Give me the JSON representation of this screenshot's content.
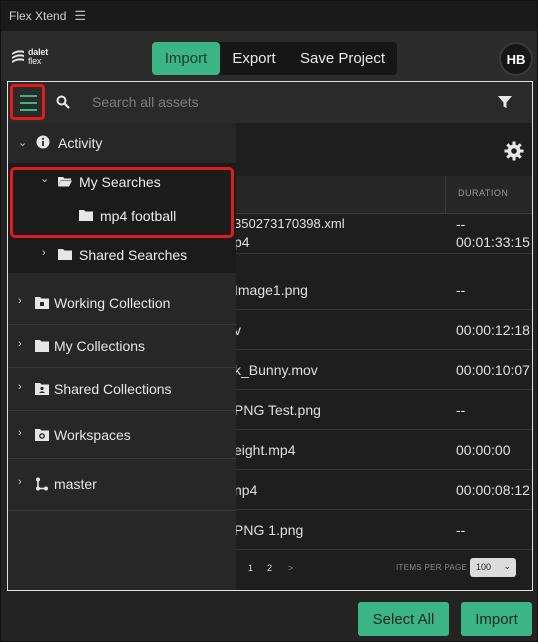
{
  "app": {
    "title": "Flex Xtend",
    "menu_icon": "hamburger-menu-icon"
  },
  "logo": {
    "line1": "dalet",
    "line2": "flex"
  },
  "tabs": [
    {
      "label": "Import",
      "active": true
    },
    {
      "label": "Export",
      "active": false
    },
    {
      "label": "Save Project",
      "active": false
    }
  ],
  "avatar": {
    "initials": "HB"
  },
  "search": {
    "placeholder": "Search all assets",
    "value": ""
  },
  "table": {
    "duration_header": "DURATION",
    "rows": [
      {
        "name": "350273170398.xml",
        "name_line2": "p4",
        "duration": "--",
        "duration_line2": "00:01:33:15"
      },
      {
        "name": "Image1.png",
        "duration": "--"
      },
      {
        "name": "v",
        "duration": "00:00:12:18"
      },
      {
        "name": "k_Bunny.mov",
        "duration": "00:00:10:07"
      },
      {
        "name": "PNG Test.png",
        "duration": "--"
      },
      {
        "name": "eight.mp4",
        "duration": "00:00:00"
      },
      {
        "name": "np4",
        "duration": "00:00:08:12"
      },
      {
        "name": "PNG 1.png",
        "duration": "--"
      }
    ],
    "pager": {
      "page1": "1",
      "page2": "2",
      "next": ">",
      "items_per_page_label": "ITEMS PER PAGE",
      "items_per_page_value": "100"
    }
  },
  "drawer": {
    "activity": "Activity",
    "my_searches": "My Searches",
    "saved_search": "mp4 football",
    "shared_searches": "Shared Searches",
    "items": [
      {
        "label": "Working Collection"
      },
      {
        "label": "My Collections"
      },
      {
        "label": "Shared Collections"
      },
      {
        "label": "Workspaces"
      },
      {
        "label": "master"
      }
    ]
  },
  "buttons": {
    "select_all": "Select All",
    "import": "Import"
  },
  "colors": {
    "accent": "#3bb585",
    "highlight": "#e01b1b"
  }
}
